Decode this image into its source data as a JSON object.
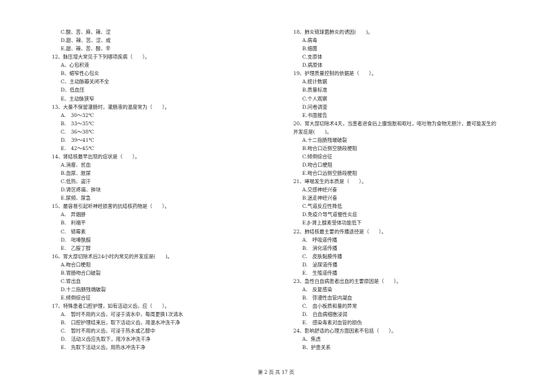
{
  "left_column": [
    {
      "type": "option",
      "text": "C.酸、苦、麻、辣、涩"
    },
    {
      "type": "option",
      "text": "D.甜、辣、苦、涩、咸"
    },
    {
      "type": "option",
      "text": "E.甜、辣、苦、酸、辛"
    },
    {
      "type": "question",
      "text": "12、脉压增大常见于下列哪项疾病（　　）。"
    },
    {
      "type": "option",
      "text": "A、心包积液"
    },
    {
      "type": "option",
      "text": "B、缩窄性心包炎"
    },
    {
      "type": "option",
      "text": "C、主动脉瓣关闭不全"
    },
    {
      "type": "option",
      "text": "D、低血压"
    },
    {
      "type": "option",
      "text": "E、主动脉狭窄"
    },
    {
      "type": "question",
      "text": "13、大量不保留灌肠时，灌肠液的温度常为（　　）。"
    },
    {
      "type": "option",
      "text": "A.　30～32℃"
    },
    {
      "type": "option",
      "text": "B.　33～35℃"
    },
    {
      "type": "option",
      "text": "C.　36～38℃"
    },
    {
      "type": "option",
      "text": "D.　39～41℃"
    },
    {
      "type": "option",
      "text": "E.　42～45℃"
    },
    {
      "type": "question",
      "text": "14、肾结核最早出现的症状是（　　）。"
    },
    {
      "type": "option",
      "text": "A.消瘦、贫血"
    },
    {
      "type": "option",
      "text": "B.血尿、脓尿"
    },
    {
      "type": "option",
      "text": "C.低热、盗汗"
    },
    {
      "type": "option",
      "text": "D.肾区疼痛、肿块"
    },
    {
      "type": "option",
      "text": "E.尿频、尿急"
    },
    {
      "type": "question",
      "text": "15、最容易引起听神经损害的抗结核药物是（　　）。"
    },
    {
      "type": "option",
      "text": "A.　异烟肼"
    },
    {
      "type": "option",
      "text": "B.　利福平"
    },
    {
      "type": "option",
      "text": "C.　链霉素"
    },
    {
      "type": "option",
      "text": "D.　吡嗪酰胺"
    },
    {
      "type": "option",
      "text": "E.　乙胺丁醇"
    },
    {
      "type": "question",
      "text": "16、胃大部切除术后24小时内常见的并发症是(　　)。"
    },
    {
      "type": "option",
      "text": "A.吻合口梗阻"
    },
    {
      "type": "option",
      "text": "B.胃肠吻合口破裂"
    },
    {
      "type": "option",
      "text": "C.胃出血"
    },
    {
      "type": "option",
      "text": "D.十二指肠残端破裂"
    },
    {
      "type": "option",
      "text": "E.倾倒综合征"
    },
    {
      "type": "question",
      "text": "17、特殊患者口腔护理，如有活动义齿，应（　　）。"
    },
    {
      "type": "option",
      "text": "A.　暂时不用的义齿，可浸于清水中，每周更换1次清水"
    },
    {
      "type": "option",
      "text": "B.　口腔护理结束后，取下活动义齿，用温水冲洗干净"
    },
    {
      "type": "option",
      "text": "C.　暂时不用的义齿，可浸于热水或乙醇中"
    },
    {
      "type": "option",
      "text": "D.　活动义齿应先取下，用冷水冲洗干净"
    },
    {
      "type": "option",
      "text": "E.　先取下活动义齿，用热水冲洗干净"
    }
  ],
  "right_column": [
    {
      "type": "question",
      "text": "18、肺炎链球菌肺炎的诱因(　　)。"
    },
    {
      "type": "option",
      "text": "A.病毒"
    },
    {
      "type": "option",
      "text": "B.细菌"
    },
    {
      "type": "option",
      "text": "C.支原体"
    },
    {
      "type": "option",
      "text": "D.病原体"
    },
    {
      "type": "question",
      "text": "19、护理质量控制的依据是（　　）。"
    },
    {
      "type": "option",
      "text": "A.统计数据"
    },
    {
      "type": "option",
      "text": "B.质量标准"
    },
    {
      "type": "option",
      "text": "C.个人观察"
    },
    {
      "type": "option",
      "text": "D.问卷调查"
    },
    {
      "type": "option",
      "text": "E.书面报告"
    },
    {
      "type": "question",
      "text": "20、胃大部切除术4天，当患者进食后上腹饱胀和呕吐，呕吐物为食物无胆汁，最可能发生的"
    },
    {
      "type": "question",
      "text": "并发症是(　　)。"
    },
    {
      "type": "option",
      "text": "A.十二指肠残端破裂"
    },
    {
      "type": "option",
      "text": "B.吻合口近侧空肠段梗阻"
    },
    {
      "type": "option",
      "text": "C.倾倒综合征"
    },
    {
      "type": "option",
      "text": "D.吻合口梗阻"
    },
    {
      "type": "option",
      "text": "E.吻合口远侧空肠段梗阻"
    },
    {
      "type": "question",
      "text": "21、哮喘发生的本质是（　　）。"
    },
    {
      "type": "option",
      "text": "A.交感神经兴奋"
    },
    {
      "type": "option",
      "text": "B.迷走神经兴奋"
    },
    {
      "type": "option",
      "text": "C.气道反应性降低"
    },
    {
      "type": "option",
      "text": "D.免疫介导气道慢性炎症"
    },
    {
      "type": "option",
      "text": "E.β-肾上腺素受体功能低下"
    },
    {
      "type": "question",
      "text": "22、肺结核最主要的传播途径是（　　）。"
    },
    {
      "type": "option",
      "text": "A.　呼吸道传播"
    },
    {
      "type": "option",
      "text": "B.　消化道传播"
    },
    {
      "type": "option",
      "text": "C.　皮肤黏膜传播"
    },
    {
      "type": "option",
      "text": "D.　泌尿道传播"
    },
    {
      "type": "option",
      "text": "E.　生殖道传播"
    },
    {
      "type": "question",
      "text": "23、急性白血病患者出血的主要原因是（　　）。"
    },
    {
      "type": "option",
      "text": "A.　反复感染"
    },
    {
      "type": "option",
      "text": "B.　弥漫性血管内凝血"
    },
    {
      "type": "option",
      "text": "C.　血小板质和量的异常"
    },
    {
      "type": "option",
      "text": "D.　白血病细胞浸润"
    },
    {
      "type": "option",
      "text": "E.　感染毒素对血管的损伤"
    },
    {
      "type": "question",
      "text": "24、影响舒适的心理方面因素不包括（　　）。"
    },
    {
      "type": "option",
      "text": "A、焦虑"
    },
    {
      "type": "option",
      "text": "B、护患关系"
    }
  ],
  "footer": {
    "page_text": "第 2 页 共 17 页"
  }
}
